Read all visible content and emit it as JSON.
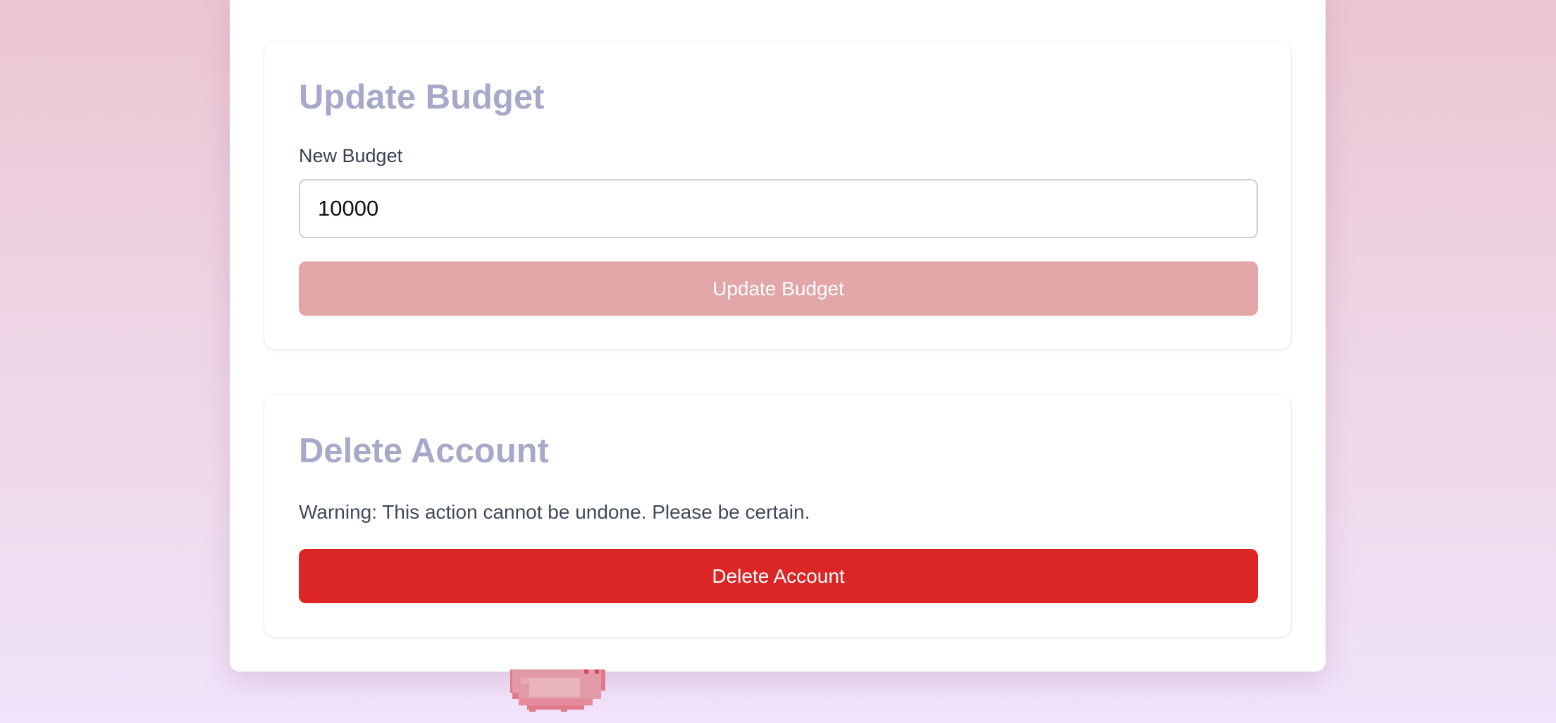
{
  "budget_card": {
    "title": "Update Budget",
    "field_label": "New Budget",
    "input_value": "10000",
    "button_label": "Update Budget"
  },
  "delete_card": {
    "title": "Delete Account",
    "warning": "Warning: This action cannot be undone. Please be certain.",
    "button_label": "Delete Account"
  },
  "mascot": {
    "icon": "pixel-pig-icon"
  },
  "colors": {
    "heading": "#a7a9c8",
    "update_button": "#e3a6a8",
    "delete_button": "#dc2626"
  }
}
